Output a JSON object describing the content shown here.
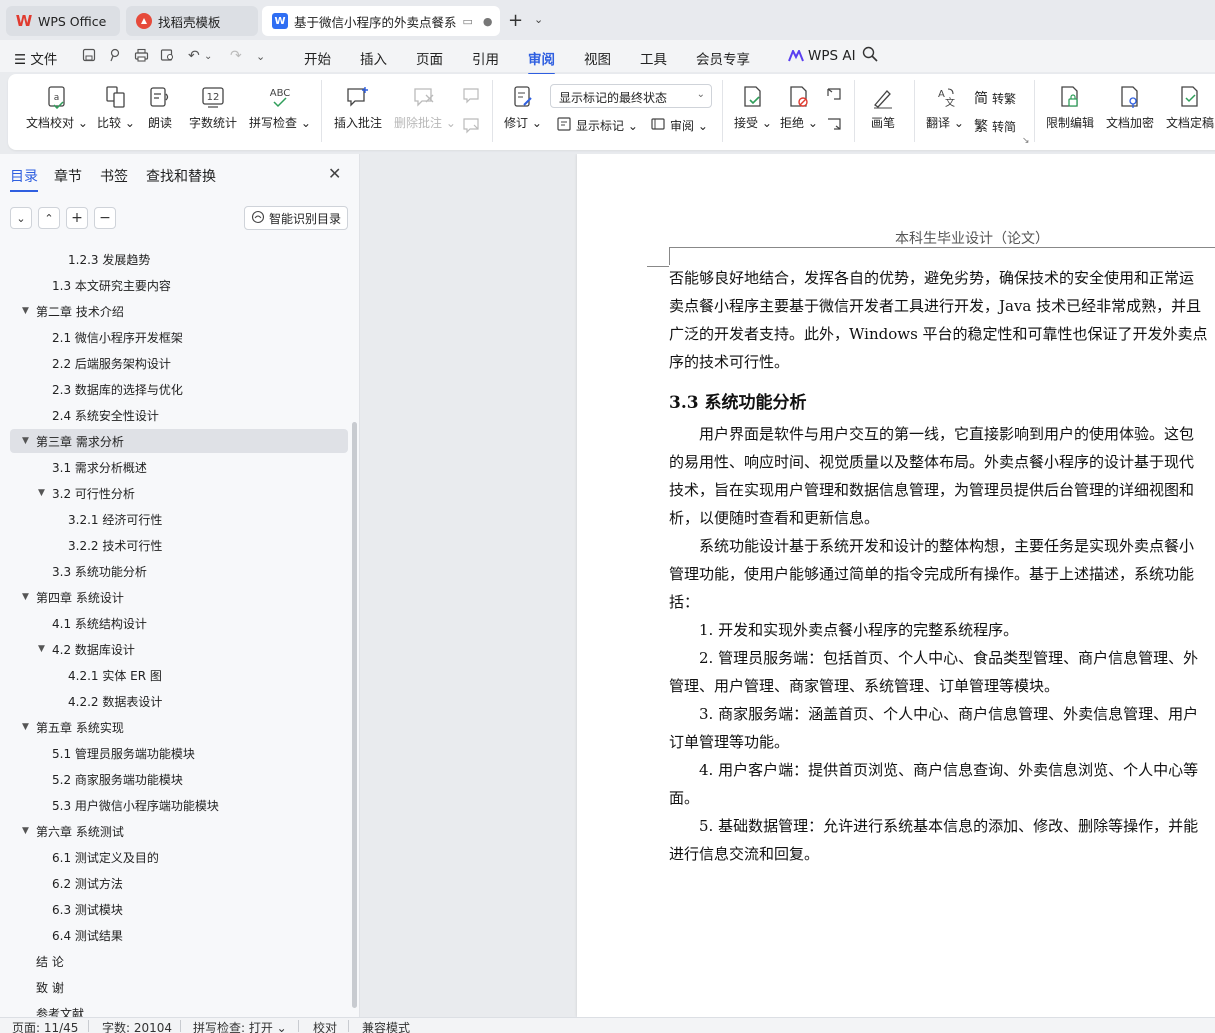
{
  "tabs": [
    {
      "label": "WPS Office",
      "icon": "wps-logo-icon"
    },
    {
      "label": "找稻壳模板",
      "icon": "template-icon"
    },
    {
      "label": "基于微信小程序的外卖点餐系",
      "icon": "document-icon"
    }
  ],
  "menu": {
    "file": "文件",
    "items": [
      "开始",
      "插入",
      "页面",
      "引用",
      "审阅",
      "视图",
      "工具",
      "会员专享"
    ],
    "active": "审阅",
    "ai": "WPS AI"
  },
  "ribbon": {
    "doc_check": "文档校对",
    "compare": "比较",
    "read_aloud": "朗读",
    "word_count": "字数统计",
    "spell_check": "拼写检查",
    "insert_comment": "插入批注",
    "delete_comment": "删除批注",
    "revise": "修订",
    "markup_mode": "显示标记的最终状态",
    "show_markup": "显示标记",
    "review": "审阅",
    "accept": "接受",
    "reject": "拒绝",
    "pen": "画笔",
    "translate": "翻译",
    "to_traditional": "转繁",
    "to_simplified": "转简",
    "restrict_edit": "限制编辑",
    "encrypt": "文档加密",
    "finalize": "文档定稿"
  },
  "nav_panel": {
    "tabs": [
      "目录",
      "章节",
      "书签",
      "查找和替换"
    ],
    "smart_toc": "智能识别目录",
    "toc": [
      {
        "label": "1.2.3  发展趋势",
        "level": 3,
        "arrow": ""
      },
      {
        "label": "1.3  本文研究主要内容",
        "level": 2,
        "arrow": ""
      },
      {
        "label": "第二章  技术介绍",
        "level": 1,
        "arrow": "▼"
      },
      {
        "label": "2.1  微信小程序开发框架",
        "level": 2,
        "arrow": ""
      },
      {
        "label": "2.2  后端服务架构设计",
        "level": 2,
        "arrow": ""
      },
      {
        "label": "2.3  数据库的选择与优化",
        "level": 2,
        "arrow": ""
      },
      {
        "label": "2.4  系统安全性设计",
        "level": 2,
        "arrow": ""
      },
      {
        "label": "第三章  需求分析",
        "level": 1,
        "arrow": "▼",
        "selected": true
      },
      {
        "label": "3.1  需求分析概述",
        "level": 2,
        "arrow": ""
      },
      {
        "label": "3.2  可行性分析",
        "level": 2,
        "arrow": "▼"
      },
      {
        "label": "3.2.1  经济可行性",
        "level": 3,
        "arrow": ""
      },
      {
        "label": "3.2.2  技术可行性",
        "level": 3,
        "arrow": ""
      },
      {
        "label": "3.3  系统功能分析",
        "level": 2,
        "arrow": ""
      },
      {
        "label": "第四章  系统设计",
        "level": 1,
        "arrow": "▼"
      },
      {
        "label": "4.1 系统结构设计",
        "level": 2,
        "arrow": ""
      },
      {
        "label": "4.2  数据库设计",
        "level": 2,
        "arrow": "▼"
      },
      {
        "label": "4.2.1  实体 ER 图",
        "level": 3,
        "arrow": ""
      },
      {
        "label": "4.2.2  数据表设计",
        "level": 3,
        "arrow": ""
      },
      {
        "label": "第五章  系统实现",
        "level": 1,
        "arrow": "▼"
      },
      {
        "label": "5.1  管理员服务端功能模块",
        "level": 2,
        "arrow": ""
      },
      {
        "label": "5.2  商家服务端功能模块",
        "level": 2,
        "arrow": ""
      },
      {
        "label": "5.3 用户微信小程序端功能模块",
        "level": 2,
        "arrow": ""
      },
      {
        "label": "第六章  系统测试",
        "level": 1,
        "arrow": "▼"
      },
      {
        "label": "6.1  测试定义及目的",
        "level": 2,
        "arrow": ""
      },
      {
        "label": "6.2  测试方法",
        "level": 2,
        "arrow": ""
      },
      {
        "label": "6.3  测试模块",
        "level": 2,
        "arrow": ""
      },
      {
        "label": "6.4  测试结果",
        "level": 2,
        "arrow": ""
      },
      {
        "label": "结    论",
        "level": 1,
        "arrow": ""
      },
      {
        "label": "致    谢",
        "level": 1,
        "arrow": ""
      },
      {
        "label": "参考文献",
        "level": 1,
        "arrow": ""
      }
    ]
  },
  "document": {
    "header": "本科生毕业设计（论文）",
    "lines_a": [
      "否能够良好地结合，发挥各自的优势，避免劣势，确保技术的安全使用和正常运",
      "卖点餐小程序主要基于微信开发者工具进行开发，Java 技术已经非常成熟，并且",
      "广泛的开发者支持。此外，Windows 平台的稳定性和可靠性也保证了开发外卖点",
      "序的技术可行性。"
    ],
    "heading": "3.3  系统功能分析",
    "lines_b": [
      "　　用户界面是软件与用户交互的第一线，它直接影响到用户的使用体验。这包",
      "的易用性、响应时间、视觉质量以及整体布局。外卖点餐小程序的设计基于现代",
      "技术，旨在实现用户管理和数据信息管理，为管理员提供后台管理的详细视图和",
      "析，以便随时查看和更新信息。",
      "　　系统功能设计基于系统开发和设计的整体构想，主要任务是实现外卖点餐小",
      "管理功能，使用户能够通过简单的指令完成所有操作。基于上述描述，系统功能",
      "括：",
      "　　1. 开发和实现外卖点餐小程序的完整系统程序。",
      "　　2. 管理员服务端：包括首页、个人中心、食品类型管理、商户信息管理、外",
      "管理、用户管理、商家管理、系统管理、订单管理等模块。",
      "　　3. 商家服务端：涵盖首页、个人中心、商户信息管理、外卖信息管理、用户",
      "订单管理等功能。",
      "　　4. 用户客户端：提供首页浏览、商户信息查询、外卖信息浏览、个人中心等",
      "面。",
      "　　5. 基础数据管理：允许进行系统基本信息的添加、修改、删除等操作，并能",
      "进行信息交流和回复。"
    ]
  },
  "status": {
    "page": "页面: 11/45",
    "words": "字数: 20104",
    "spell": "拼写检查: 打开",
    "proof": "校对",
    "compat": "兼容模式"
  },
  "colors": {
    "accent": "#2f5fe0",
    "wps_red": "#e03a2f"
  }
}
